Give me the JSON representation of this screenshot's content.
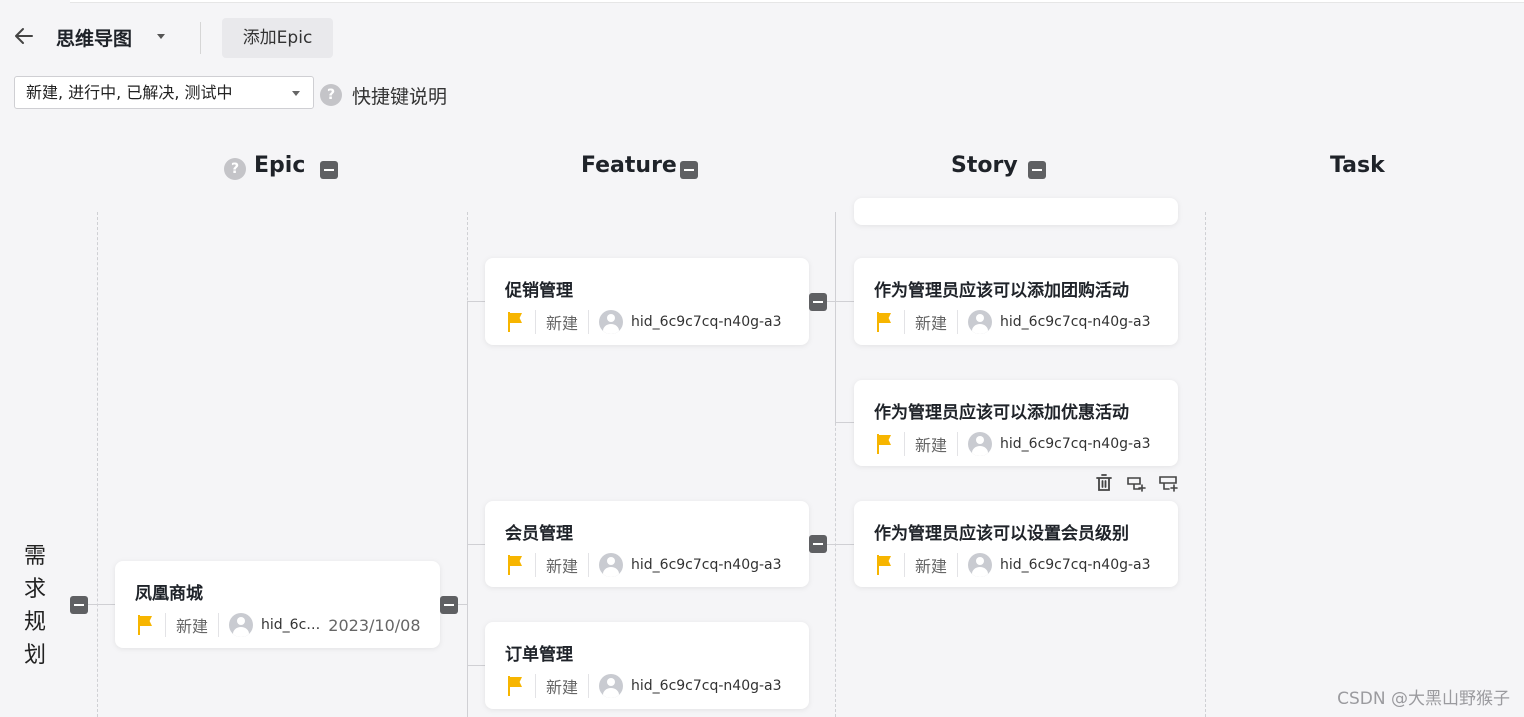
{
  "header": {
    "title": "思维导图",
    "add_epic_label": "添加Epic"
  },
  "filter": {
    "selected": "新建, 进行中, 已解决, 测试中",
    "shortcut_help": "快捷键说明"
  },
  "columns": {
    "epic": "Epic",
    "feature": "Feature",
    "story": "Story",
    "task": "Task"
  },
  "row_label": [
    "需",
    "求",
    "规",
    "划"
  ],
  "epic_card": {
    "title": "凤凰商城",
    "status": "新建",
    "assignee": "hid_6c…",
    "date": "2023/10/08"
  },
  "features": [
    {
      "title": "促销管理",
      "status": "新建",
      "assignee": "hid_6c9c7cq-n40g-a3"
    },
    {
      "title": "会员管理",
      "status": "新建",
      "assignee": "hid_6c9c7cq-n40g-a3"
    },
    {
      "title": "订单管理",
      "status": "新建",
      "assignee": "hid_6c9c7cq-n40g-a3"
    }
  ],
  "stories": [
    {
      "title": "作为管理员应该可以添加团购活动",
      "status": "新建",
      "assignee": "hid_6c9c7cq-n40g-a3"
    },
    {
      "title": "作为管理员应该可以添加优惠活动",
      "status": "新建",
      "assignee": "hid_6c9c7cq-n40g-a3"
    },
    {
      "title": "作为管理员应该可以设置会员级别",
      "status": "新建",
      "assignee": "hid_6c9c7cq-n40g-a3"
    }
  ],
  "icons": {
    "back": "arrow-left-icon",
    "help": "question-circle-icon",
    "collapse": "minus-square-icon",
    "flag": "flag-icon",
    "avatar": "user-avatar-icon",
    "delete": "trash-icon",
    "add_child": "add-child-icon",
    "add_sibling": "add-sibling-icon"
  },
  "colors": {
    "flag": "#f7b500",
    "collapse_button": "#5f6063",
    "background": "#f5f5f7"
  },
  "watermark": "CSDN @大黑山野猴子"
}
